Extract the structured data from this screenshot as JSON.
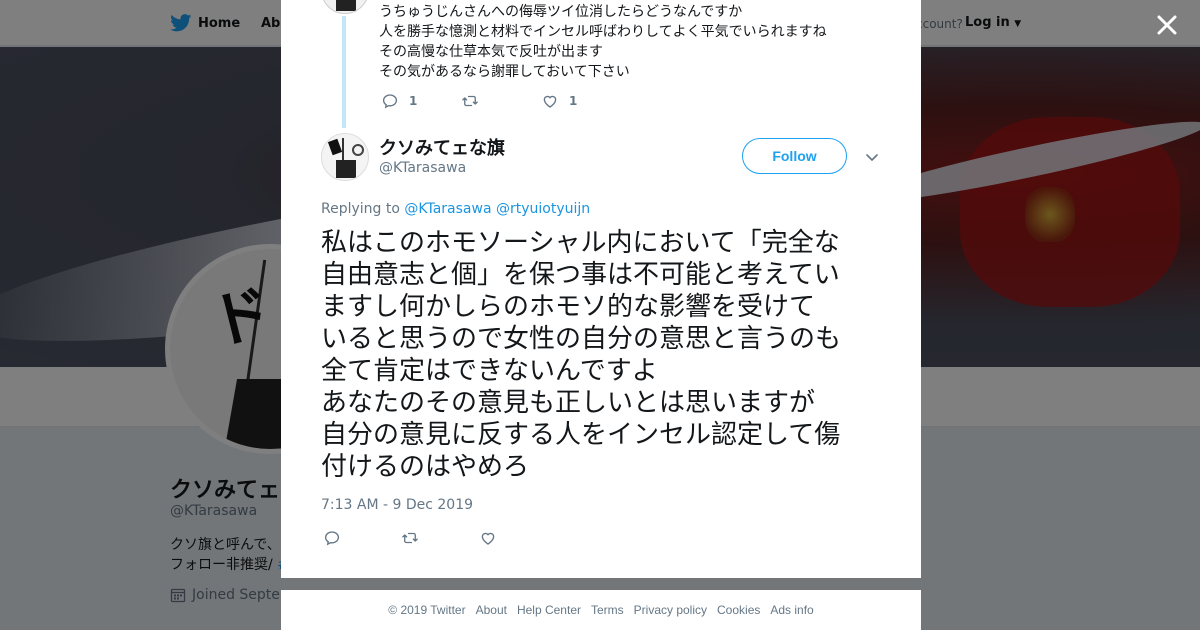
{
  "nav": {
    "home": "Home",
    "about": "Abo",
    "account": "ccount?",
    "login": "Log in"
  },
  "profile": {
    "name": "クソみてェ",
    "handle": "@KTarasawa",
    "bio_line1": "クソ旗と呼んで、",
    "bio_line2": "フォロー非推奨/ ",
    "bio_tag": "#",
    "joined": "Joined Septer",
    "avatar_text": "折れねェ"
  },
  "parent_tweet": {
    "lines": [
      "うちゅうじんさんへの侮辱ツイ位消したらどうなんですか",
      "人を勝手な憶測と材料でインセル呼ばわりしてよく平気でいられますね",
      "その高慢な仕草本気で反吐が出ます",
      "その気があるなら謝罪しておいて下さい"
    ],
    "reply_count": "1",
    "like_count": "1"
  },
  "tweet": {
    "name": "クソみてェな旗",
    "handle": "@KTarasawa",
    "follow_label": "Follow",
    "replying_prefix": "Replying to ",
    "mention1": "@KTarasawa",
    "mention2": "@rtyuiotyuijn",
    "text_lines": [
      "私はこのホモソーシャル内において「完全な",
      "自由意志と個」を保つ事は不可能と考えてい",
      "ますし何かしらのホモソ的な影響を受けて",
      "いると思うので女性の自分の意思と言うのも",
      "全て肯定はできないんですよ",
      "あなたのその意見も正しいとは思いますが",
      "自分の意見に反する人をインセル認定して傷",
      "付けるのはやめろ"
    ],
    "timestamp": "7:13 AM - 9 Dec 2019"
  },
  "footer": {
    "links": [
      "© 2019 Twitter",
      "About",
      "Help Center",
      "Terms",
      "Privacy policy",
      "Cookies",
      "Ads info"
    ]
  },
  "colors": {
    "accent": "#1da1f2",
    "text": "#14171a",
    "muted": "#657786",
    "thread_line": "#c4e6fa"
  },
  "icons": [
    "twitter-bird-icon",
    "chevron-down-icon",
    "close-icon",
    "reply-icon",
    "retweet-icon",
    "like-icon",
    "calendar-icon"
  ]
}
